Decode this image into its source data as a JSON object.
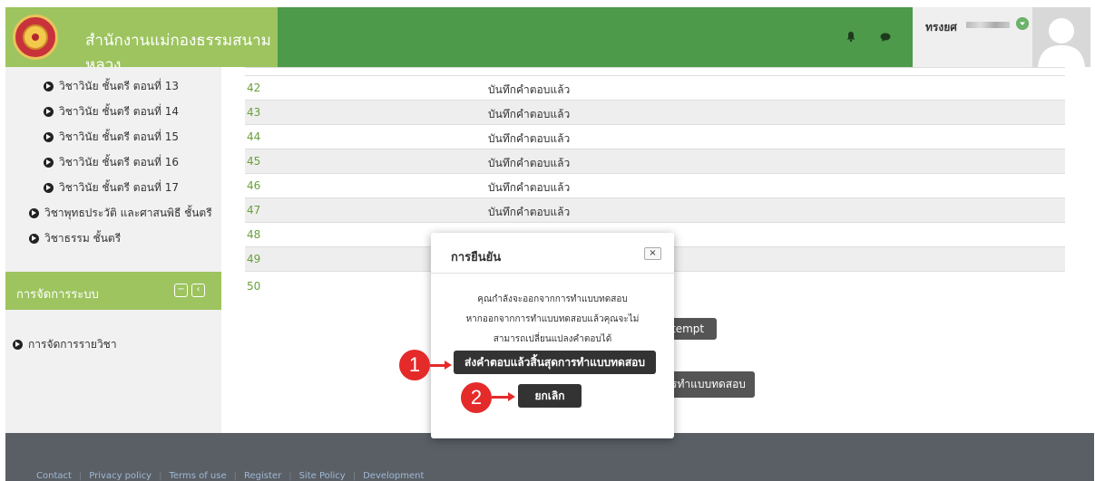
{
  "header": {
    "site_title": "สำนักงานแม่กองธรรมสนามหลวง",
    "user_name": "ทรงยศ",
    "icons": [
      "bell-icon",
      "chat-icon",
      "chevron-down-icon"
    ]
  },
  "sidebar": {
    "items": [
      {
        "label": "วิชาวินัย ชั้นตรี ตอนที่ 13"
      },
      {
        "label": "วิชาวินัย ชั้นตรี ตอนที่ 14"
      },
      {
        "label": "วิชาวินัย ชั้นตรี ตอนที่ 15"
      },
      {
        "label": "วิชาวินัย ชั้นตรี ตอนที่ 16"
      },
      {
        "label": "วิชาวินัย ชั้นตรี ตอนที่ 17"
      },
      {
        "label": "วิชาพุทธประวัติ และศาสนพิธี ชั้นตรี"
      },
      {
        "label": "วิชาธรรม ชั้นตรี"
      }
    ],
    "system_title": "การจัดการระบบ",
    "system_items": [
      {
        "label": "การจัดการรายวิชา"
      }
    ]
  },
  "questions": [
    {
      "num": "42",
      "status": "บันทึกคำตอบแล้ว"
    },
    {
      "num": "43",
      "status": "บันทึกคำตอบแล้ว"
    },
    {
      "num": "44",
      "status": "บันทึกคำตอบแล้ว"
    },
    {
      "num": "45",
      "status": "บันทึกคำตอบแล้ว"
    },
    {
      "num": "46",
      "status": "บันทึกคำตอบแล้ว"
    },
    {
      "num": "47",
      "status": "บันทึกคำตอบแล้ว"
    },
    {
      "num": "48",
      "status": ""
    },
    {
      "num": "49",
      "status": ""
    },
    {
      "num": "50",
      "status": ""
    }
  ],
  "background_buttons": {
    "attempt_label": "tempt",
    "finish_label": "รทำแบบทดสอบ"
  },
  "footer": {
    "links": [
      "Contact",
      "Privacy policy",
      "Terms of use",
      "Register",
      "Site Policy",
      "Development"
    ]
  },
  "modal": {
    "title": "การยืนยัน",
    "close_label": "×",
    "message_line1": "คุณกำลังจะออกจากการทำแบบทดสอบ",
    "message_line2": "หากออกจากการทำแบบทดสอบแล้วคุณจะไม่",
    "message_line3": "สามารถเปลี่ยนแปลงคำตอบได้",
    "submit_label": "ส่งคำตอบแล้วสิ้นสุดการทำแบบทดสอบ",
    "cancel_label": "ยกเลิก"
  },
  "callouts": {
    "one": "1",
    "two": "2",
    "color": "#e52a2a"
  }
}
